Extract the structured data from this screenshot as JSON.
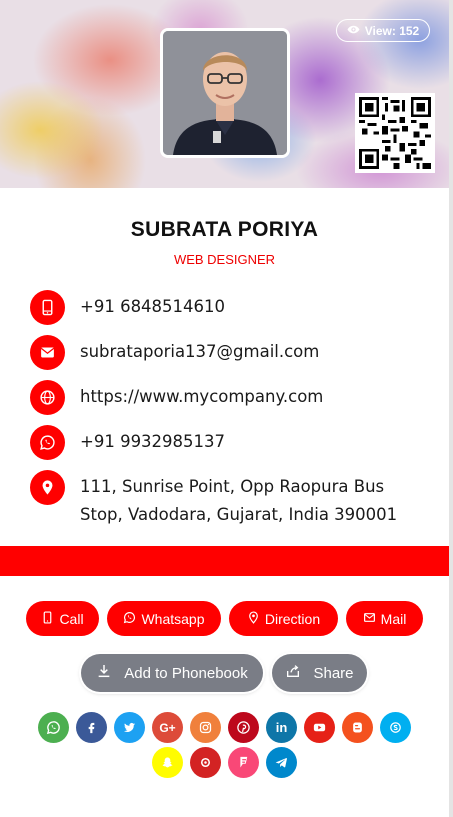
{
  "header": {
    "view_label": "View: 152"
  },
  "profile": {
    "name": "SUBRATA PORIYA",
    "designation": "WEB DESIGNER"
  },
  "contacts": [
    {
      "icon": "mobile-phone-icon",
      "text": "+91 6848514610"
    },
    {
      "icon": "envelope-icon",
      "text": "subrataporia137@gmail.com"
    },
    {
      "icon": "globe-icon",
      "text": "https://www.mycompany.com"
    },
    {
      "icon": "whatsapp-icon",
      "text": "+91 9932985137"
    },
    {
      "icon": "map-marker-icon",
      "text_line1": "111, Sunrise Point, Opp Raopura Bus",
      "text_line2": "Stop, Vadodara, Gujarat, India 390001"
    }
  ],
  "actions": {
    "call": "Call",
    "whatsapp": "Whatsapp",
    "direction": "Direction",
    "mail": "Mail",
    "add_phonebook": "Add to Phonebook",
    "share": "Share"
  },
  "social": [
    {
      "name": "whatsapp",
      "color": "#4caf50"
    },
    {
      "name": "facebook",
      "color": "#3b5998"
    },
    {
      "name": "twitter",
      "color": "#1da1f2"
    },
    {
      "name": "google-plus",
      "color": "#dd4b39"
    },
    {
      "name": "instagram",
      "color": "#f0803c"
    },
    {
      "name": "pinterest",
      "color": "#bd081c"
    },
    {
      "name": "linkedin",
      "color": "#0e76a8"
    },
    {
      "name": "youtube",
      "color": "#e62117"
    },
    {
      "name": "blogger",
      "color": "#f4511e"
    },
    {
      "name": "skype",
      "color": "#00aff0"
    },
    {
      "name": "snapchat",
      "color": "#fffc00"
    },
    {
      "name": "yelp",
      "color": "#d32323"
    },
    {
      "name": "foursquare",
      "color": "#f94877"
    },
    {
      "name": "telegram",
      "color": "#0088cc"
    }
  ],
  "colors": {
    "accent": "#ff0000",
    "button_grey": "#7a7d86"
  }
}
